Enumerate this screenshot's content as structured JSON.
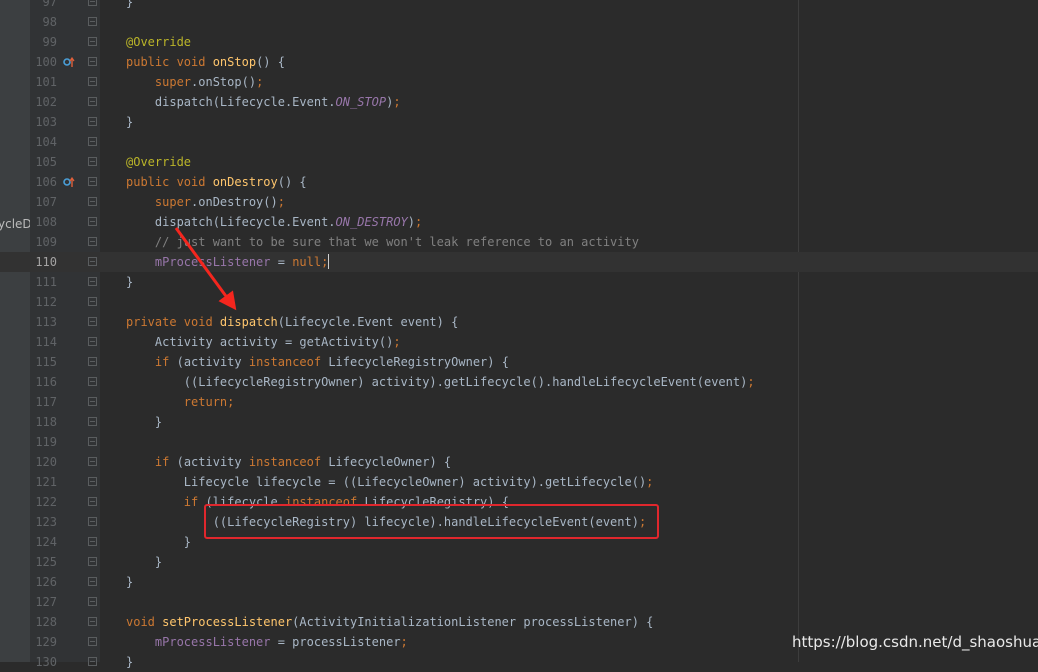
{
  "left_panel": {
    "clipped_text": "ycleD"
  },
  "watermark": "https://blog.csdn.net/d_shaoshuai",
  "lines": [
    {
      "n": "97",
      "tokens": [
        [
          "}",
          ""
        ]
      ]
    },
    {
      "n": "98",
      "tokens": []
    },
    {
      "n": "99",
      "tokens": [
        [
          "@Override",
          "an"
        ]
      ]
    },
    {
      "n": "100",
      "marker": true,
      "tokens": [
        [
          "public ",
          "kw"
        ],
        [
          "void ",
          "kw"
        ],
        [
          "onStop",
          "fn"
        ],
        [
          "() {",
          ""
        ]
      ]
    },
    {
      "n": "101",
      "tokens": [
        [
          "    ",
          ""
        ],
        [
          "super",
          "kw"
        ],
        [
          ".onStop()",
          ""
        ],
        [
          ";",
          "kw"
        ]
      ]
    },
    {
      "n": "102",
      "tokens": [
        [
          "    dispatch(Lifecycle.Event.",
          ""
        ],
        [
          "ON_STOP",
          "it"
        ],
        [
          ")",
          ""
        ],
        [
          ";",
          "kw"
        ]
      ]
    },
    {
      "n": "103",
      "tokens": [
        [
          "}",
          ""
        ]
      ]
    },
    {
      "n": "104",
      "tokens": []
    },
    {
      "n": "105",
      "tokens": [
        [
          "@Override",
          "an"
        ]
      ]
    },
    {
      "n": "106",
      "marker": true,
      "tokens": [
        [
          "public ",
          "kw"
        ],
        [
          "void ",
          "kw"
        ],
        [
          "onDestroy",
          "fn"
        ],
        [
          "() {",
          ""
        ]
      ]
    },
    {
      "n": "107",
      "tokens": [
        [
          "    ",
          ""
        ],
        [
          "super",
          "kw"
        ],
        [
          ".onDestroy()",
          ""
        ],
        [
          ";",
          "kw"
        ]
      ]
    },
    {
      "n": "108",
      "tokens": [
        [
          "    dispatch(Lifecycle.Event.",
          ""
        ],
        [
          "ON_DESTROY",
          "it"
        ],
        [
          ")",
          ""
        ],
        [
          ";",
          "kw"
        ]
      ]
    },
    {
      "n": "109",
      "tokens": [
        [
          "    // just want to be sure that we won't leak reference to an activity",
          "cm"
        ]
      ]
    },
    {
      "n": "110",
      "current": true,
      "caret": true,
      "tokens": [
        [
          "    ",
          ""
        ],
        [
          "mProcessListener",
          "pf"
        ],
        [
          " = ",
          ""
        ],
        [
          "null",
          "kw"
        ],
        [
          ";",
          "kw"
        ]
      ]
    },
    {
      "n": "111",
      "tokens": [
        [
          "}",
          ""
        ]
      ]
    },
    {
      "n": "112",
      "tokens": []
    },
    {
      "n": "113",
      "tokens": [
        [
          "private ",
          "kw"
        ],
        [
          "void ",
          "kw"
        ],
        [
          "dispatch",
          "fn"
        ],
        [
          "(Lifecycle.Event event) {",
          ""
        ]
      ]
    },
    {
      "n": "114",
      "tokens": [
        [
          "    Activity activity = getActivity()",
          ""
        ],
        [
          ";",
          "kw"
        ]
      ]
    },
    {
      "n": "115",
      "tokens": [
        [
          "    ",
          ""
        ],
        [
          "if ",
          "kw"
        ],
        [
          "(activity ",
          ""
        ],
        [
          "instanceof ",
          "kw"
        ],
        [
          "LifecycleRegistryOwner) {",
          ""
        ]
      ]
    },
    {
      "n": "116",
      "tokens": [
        [
          "        ((LifecycleRegistryOwner) activity).getLifecycle().handleLifecycleEvent(event)",
          ""
        ],
        [
          ";",
          "kw"
        ]
      ]
    },
    {
      "n": "117",
      "tokens": [
        [
          "        ",
          ""
        ],
        [
          "return;",
          "kw"
        ]
      ]
    },
    {
      "n": "118",
      "tokens": [
        [
          "    }",
          ""
        ]
      ]
    },
    {
      "n": "119",
      "tokens": []
    },
    {
      "n": "120",
      "tokens": [
        [
          "    ",
          ""
        ],
        [
          "if ",
          "kw"
        ],
        [
          "(activity ",
          ""
        ],
        [
          "instanceof ",
          "kw"
        ],
        [
          "LifecycleOwner) {",
          ""
        ]
      ]
    },
    {
      "n": "121",
      "tokens": [
        [
          "        Lifecycle lifecycle = ((LifecycleOwner) activity).getLifecycle()",
          ""
        ],
        [
          ";",
          "kw"
        ]
      ]
    },
    {
      "n": "122",
      "tokens": [
        [
          "        ",
          ""
        ],
        [
          "if ",
          "kw"
        ],
        [
          "(lifecycle ",
          ""
        ],
        [
          "instanceof ",
          "kw"
        ],
        [
          "LifecycleRegistry) {",
          ""
        ]
      ]
    },
    {
      "n": "123",
      "tokens": [
        [
          "            ((LifecycleRegistry) lifecycle).handleLifecycleEvent(event)",
          ""
        ],
        [
          ";",
          "kw"
        ]
      ]
    },
    {
      "n": "124",
      "tokens": [
        [
          "        }",
          ""
        ]
      ]
    },
    {
      "n": "125",
      "tokens": [
        [
          "    }",
          ""
        ]
      ]
    },
    {
      "n": "126",
      "tokens": [
        [
          "}",
          ""
        ]
      ]
    },
    {
      "n": "127",
      "tokens": []
    },
    {
      "n": "128",
      "tokens": [
        [
          "void ",
          "kw"
        ],
        [
          "setProcessListener",
          "fn"
        ],
        [
          "(ActivityInitializationListener processListener) {",
          ""
        ]
      ]
    },
    {
      "n": "129",
      "tokens": [
        [
          "    ",
          ""
        ],
        [
          "mProcessListener",
          "pf"
        ],
        [
          " = processListener",
          ""
        ],
        [
          ";",
          "kw"
        ]
      ]
    },
    {
      "n": "130",
      "tokens": [
        [
          "}",
          ""
        ]
      ]
    }
  ]
}
